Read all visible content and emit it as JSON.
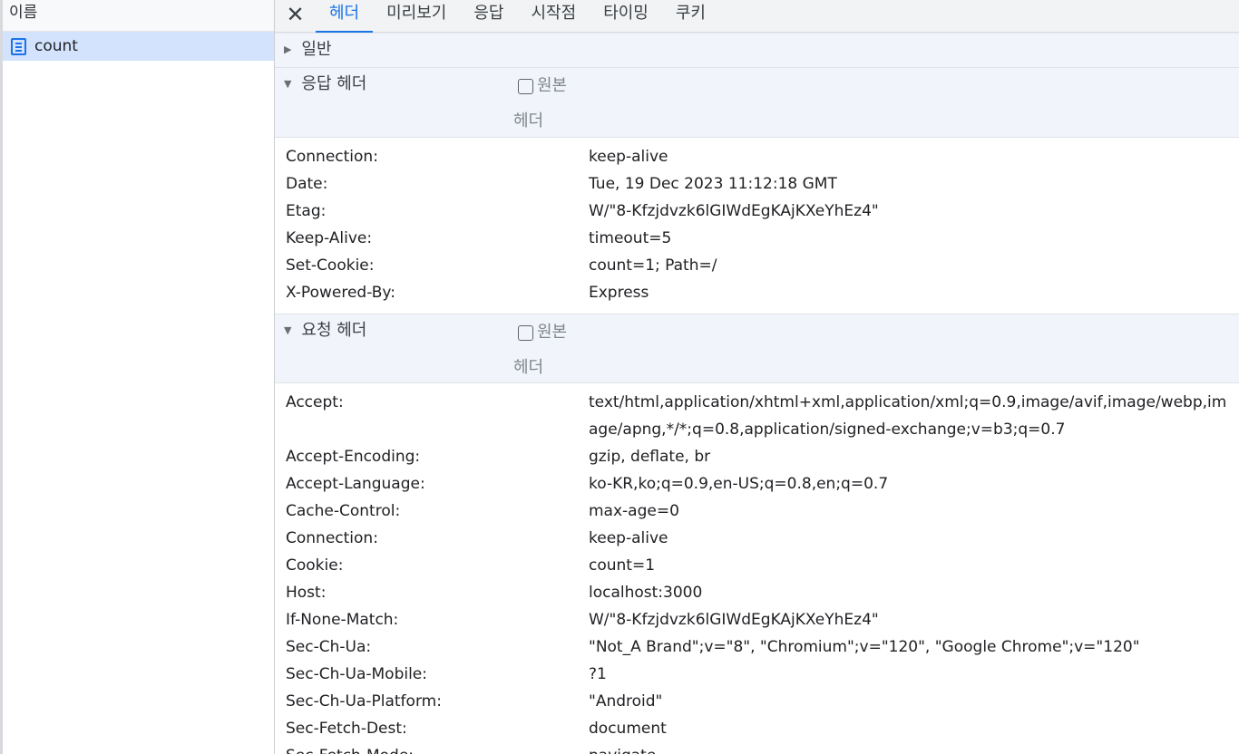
{
  "left_panel": {
    "header": "이름",
    "items": [
      {
        "label": "count",
        "icon": "document-icon",
        "selected": true
      }
    ]
  },
  "tabs": {
    "close_glyph": "✕",
    "items": [
      "헤더",
      "미리보기",
      "응답",
      "시작점",
      "타이밍",
      "쿠키"
    ],
    "active": "헤더"
  },
  "general": {
    "title": "일반",
    "collapsed": true
  },
  "response_headers": {
    "title": "응답 헤더",
    "raw_label": "원본",
    "raw_label2": "헤더",
    "raw_checked": false,
    "rows": [
      {
        "k": "Connection:",
        "v": "keep-alive"
      },
      {
        "k": "Date:",
        "v": "Tue, 19 Dec 2023 11:12:18 GMT"
      },
      {
        "k": "Etag:",
        "v": "W/\"8-Kfzjdvzk6lGIWdEgKAjKXeYhEz4\""
      },
      {
        "k": "Keep-Alive:",
        "v": "timeout=5"
      },
      {
        "k": "Set-Cookie:",
        "v": "count=1; Path=/"
      },
      {
        "k": "X-Powered-By:",
        "v": "Express"
      }
    ]
  },
  "request_headers": {
    "title": "요청 헤더",
    "raw_label": "원본",
    "raw_label2": "헤더",
    "raw_checked": false,
    "rows": [
      {
        "k": "Accept:",
        "v": "text/html,application/xhtml+xml,application/xml;q=0.9,image/avif,image/webp,image/apng,*/*;q=0.8,application/signed-exchange;v=b3;q=0.7"
      },
      {
        "k": "Accept-Encoding:",
        "v": "gzip, deflate, br"
      },
      {
        "k": "Accept-Language:",
        "v": "ko-KR,ko;q=0.9,en-US;q=0.8,en;q=0.7"
      },
      {
        "k": "Cache-Control:",
        "v": "max-age=0"
      },
      {
        "k": "Connection:",
        "v": "keep-alive"
      },
      {
        "k": "Cookie:",
        "v": "count=1"
      },
      {
        "k": "Host:",
        "v": "localhost:3000"
      },
      {
        "k": "If-None-Match:",
        "v": "W/\"8-Kfzjdvzk6lGIWdEgKAjKXeYhEz4\""
      },
      {
        "k": "Sec-Ch-Ua:",
        "v": "\"Not_A Brand\";v=\"8\", \"Chromium\";v=\"120\", \"Google Chrome\";v=\"120\""
      },
      {
        "k": "Sec-Ch-Ua-Mobile:",
        "v": "?1"
      },
      {
        "k": "Sec-Ch-Ua-Platform:",
        "v": "\"Android\""
      },
      {
        "k": "Sec-Fetch-Dest:",
        "v": "document"
      },
      {
        "k": "Sec-Fetch-Mode:",
        "v": "navigate"
      }
    ]
  },
  "colors": {
    "accent": "#1a73e8",
    "selected_row": "#d3e3fd",
    "section_bg": "#f1f5fb"
  }
}
